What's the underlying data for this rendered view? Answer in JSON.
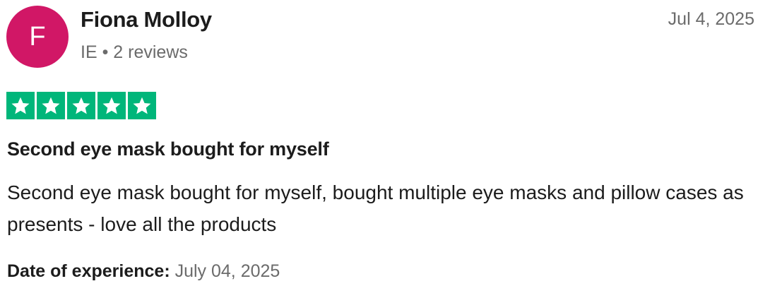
{
  "reviewer": {
    "initial": "F",
    "name": "Fiona Molloy",
    "country": "IE",
    "separator": "•",
    "review_count": "2 reviews",
    "avatar_color": "#d11766"
  },
  "review": {
    "posted_date": "Jul 4, 2025",
    "rating": 5,
    "rating_max": 5,
    "star_color": "#00b67a",
    "title": "Second eye mask bought for myself",
    "body": "Second eye mask bought for myself, bought multiple eye masks and pillow cases as presents - love all the products",
    "experience_label": "Date of experience:",
    "experience_date": "July 04, 2025"
  }
}
